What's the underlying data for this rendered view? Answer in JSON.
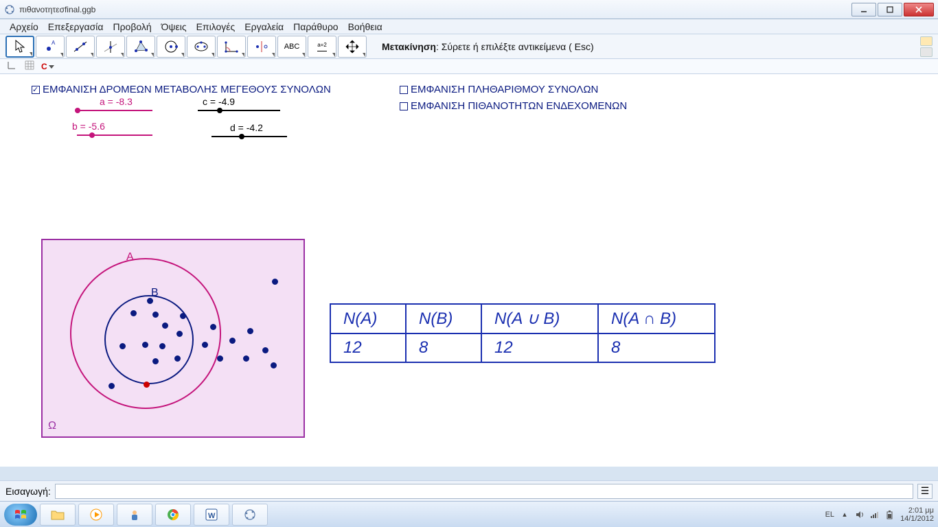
{
  "window": {
    "title": "πιθανοτητεσfinal.ggb"
  },
  "menu": {
    "file": "Αρχείο",
    "edit": "Επεξεργασία",
    "view": "Προβολή",
    "perspectives": "Όψεις",
    "options": "Επιλογές",
    "tools": "Εργαλεία",
    "window": "Παράθυρο",
    "help": "Βοήθεια"
  },
  "toolbar": {
    "hint_bold": "Μετακίνηση",
    "hint_rest": ": Σύρετε ή επιλέξτε αντικείμενα ( Esc)",
    "abc_label": "ABC",
    "measure_label": "a=2",
    "c_label": "C"
  },
  "checkboxes": {
    "sliders": "ΕΜΦΑΝΙΣΗ ΔΡΟΜΕΩΝ ΜΕΤΑΒΟΛΗΣ ΜΕΓΕΘΟΥΣ ΣΥΝΟΛΩΝ",
    "cardinality": "ΕΜΦΑΝΙΣΗ ΠΛΗΘΑΡΙΘΜΟΥ ΣΥΝΟΛΩΝ",
    "probabilities": "ΕΜΦΑΝΙΣΗ ΠΙΘΑΝΟΤΗΤΩΝ ΕΝΔΕΧΟΜΕΝΩΝ"
  },
  "sliders": {
    "a": "a = -8.3",
    "b": "b = -5.6",
    "c": "c = -4.9",
    "d": "d = -4.2"
  },
  "venn": {
    "A": "Α",
    "B": "Β",
    "Omega": "Ω"
  },
  "table": {
    "h_na": "N(A)",
    "h_nb": "N(B)",
    "h_union": "N(A ∪ B)",
    "h_inter": "N(A ∩ B)",
    "v_na": "12",
    "v_nb": "8",
    "v_union": "12",
    "v_inter": "8"
  },
  "input": {
    "label": "Εισαγωγή:",
    "placeholder": "",
    "btn": "☰"
  },
  "tray": {
    "lang": "EL",
    "time": "2:01 μμ",
    "date": "14/1/2012"
  },
  "chart_data": {
    "type": "table",
    "title": "Set cardinalities",
    "columns": [
      "N(A)",
      "N(B)",
      "N(A ∪ B)",
      "N(A ∩ B)"
    ],
    "values": [
      12,
      8,
      12,
      8
    ],
    "sliders": {
      "a": -8.3,
      "b": -5.6,
      "c": -4.9,
      "d": -4.2
    },
    "sets": {
      "A_count": 12,
      "B_count": 8,
      "union": 12,
      "intersection": 8
    }
  }
}
